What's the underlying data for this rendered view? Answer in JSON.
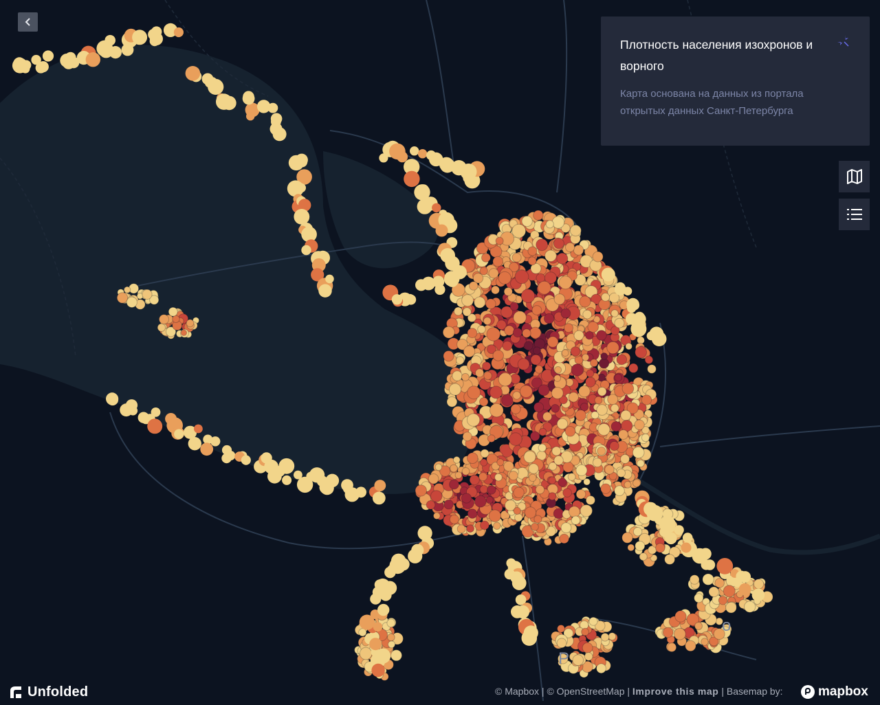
{
  "map": {
    "colors": {
      "background": "#0c1320",
      "water": "#16222f",
      "roads": "#2b3a4e",
      "density_scale": [
        "#f2d58a",
        "#efc57a",
        "#e99f5b",
        "#de7344",
        "#c8463a",
        "#9e2737",
        "#6e1a33"
      ]
    },
    "place_labels": [
      "Р",
      "о"
    ]
  },
  "collapse_button": {
    "icon": "chevron-left-icon"
  },
  "info_panel": {
    "title": "Плотность населения изохронов и ворного",
    "description": "Карта основана на данных из портала открытых данных Санкт-Петербурга",
    "icon": "sparkle-icon",
    "accent_color": "#6a6ff0"
  },
  "side_toolbar": [
    {
      "name": "map-layers-button",
      "icon": "map-icon"
    },
    {
      "name": "legend-button",
      "icon": "list-icon"
    }
  ],
  "footer": {
    "brand": "Unfolded",
    "attribution": {
      "mapbox": "© Mapbox",
      "separator1": " | ",
      "osm": "© OpenStreetMap",
      "separator2": " | ",
      "improve": "Improve this map",
      "separator3": " | ",
      "basemap": "Basemap by:"
    },
    "mapbox_logo": "mapbox"
  }
}
